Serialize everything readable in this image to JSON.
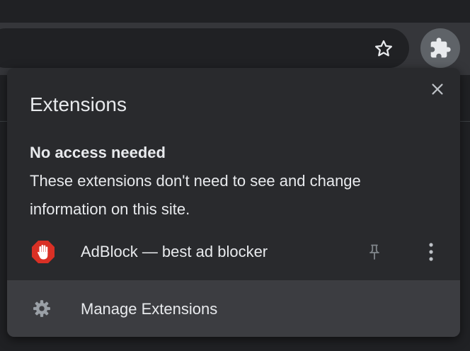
{
  "popup": {
    "title": "Extensions",
    "section_heading": "No access needed",
    "section_description": "These extensions don't need to see and change information on this site.",
    "extensions": [
      {
        "name": "AdBlock — best ad blocker",
        "icon": "adblock-hand-icon",
        "pinned": false
      }
    ],
    "manage_label": "Manage Extensions"
  },
  "toolbar": {
    "star_icon": "bookmark-star-icon",
    "extensions_icon": "puzzle-piece-icon"
  },
  "colors": {
    "popup_bg": "#292a2d",
    "text": "#e8eaed",
    "adblock_red": "#d93025",
    "manage_row_bg": "#3c3d41"
  }
}
